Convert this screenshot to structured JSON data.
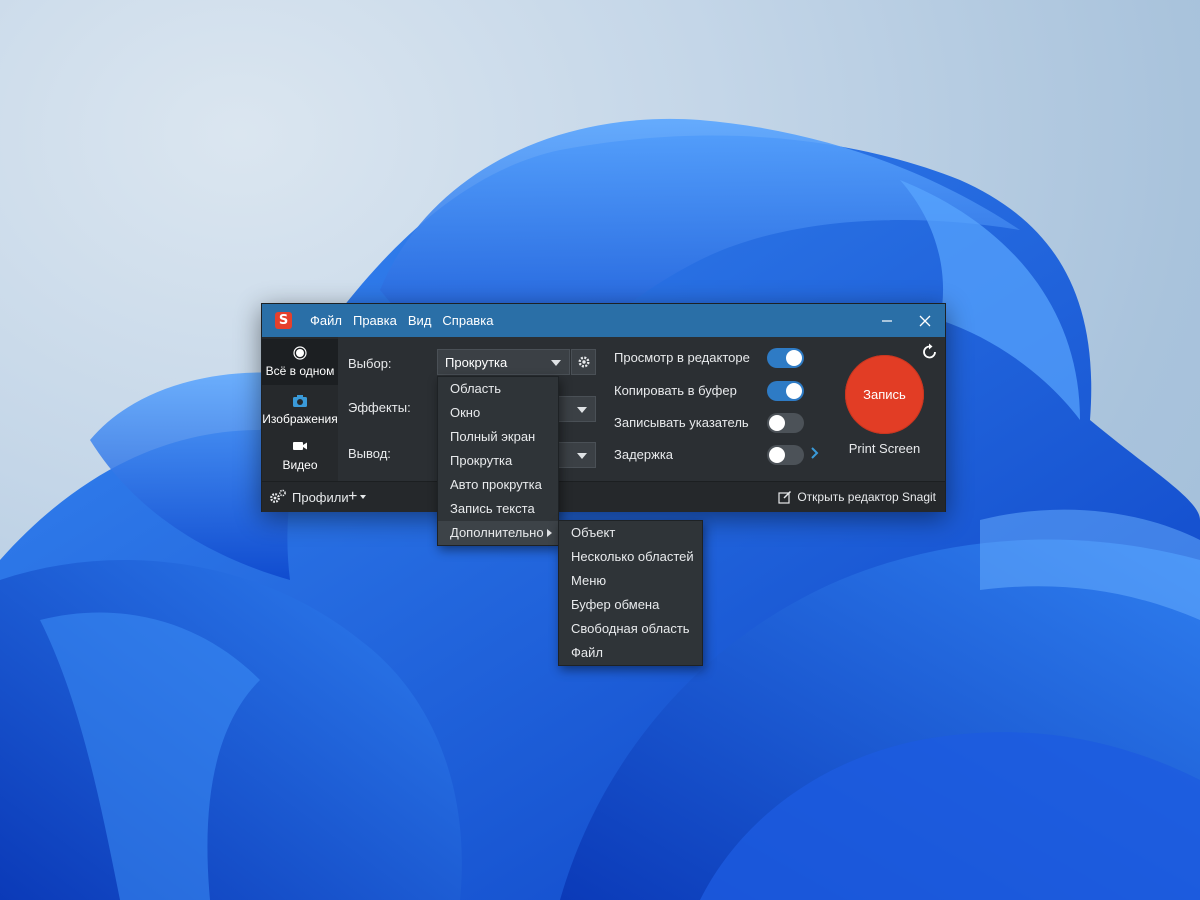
{
  "app": {
    "logo_letter": "S",
    "menu": [
      "Файл",
      "Правка",
      "Вид",
      "Справка"
    ],
    "accent_color": "#2a6fa7",
    "record_color": "#e23d25"
  },
  "modes": [
    {
      "label": "Всё в одном",
      "icon": "record-circle-icon",
      "active": true
    },
    {
      "label": "Изображения",
      "icon": "camera-icon",
      "active": false
    },
    {
      "label": "Видео",
      "icon": "video-camera-icon",
      "active": false
    }
  ],
  "settings": {
    "selection_label": "Выбор:",
    "selection_value": "Прокрутка",
    "effects_label": "Эффекты:",
    "output_label": "Вывод:"
  },
  "options": [
    {
      "label": "Просмотр в редакторе",
      "on": true
    },
    {
      "label": "Копировать в буфер",
      "on": true
    },
    {
      "label": "Записывать указатель",
      "on": false
    },
    {
      "label": "Задержка",
      "on": false
    }
  ],
  "capture": {
    "button_label": "Запись",
    "hotkey": "Print Screen"
  },
  "bottom": {
    "profiles_label": "Профили",
    "add_label": "+",
    "open_editor_label": "Открыть редактор Snagit"
  },
  "selection_menu": [
    "Область",
    "Окно",
    "Полный экран",
    "Прокрутка",
    "Авто прокрутка",
    "Запись текста",
    "Дополнительно"
  ],
  "advanced_menu": [
    "Объект",
    "Несколько областей",
    "Меню",
    "Буфер обмена",
    "Свободная область",
    "Файл"
  ]
}
